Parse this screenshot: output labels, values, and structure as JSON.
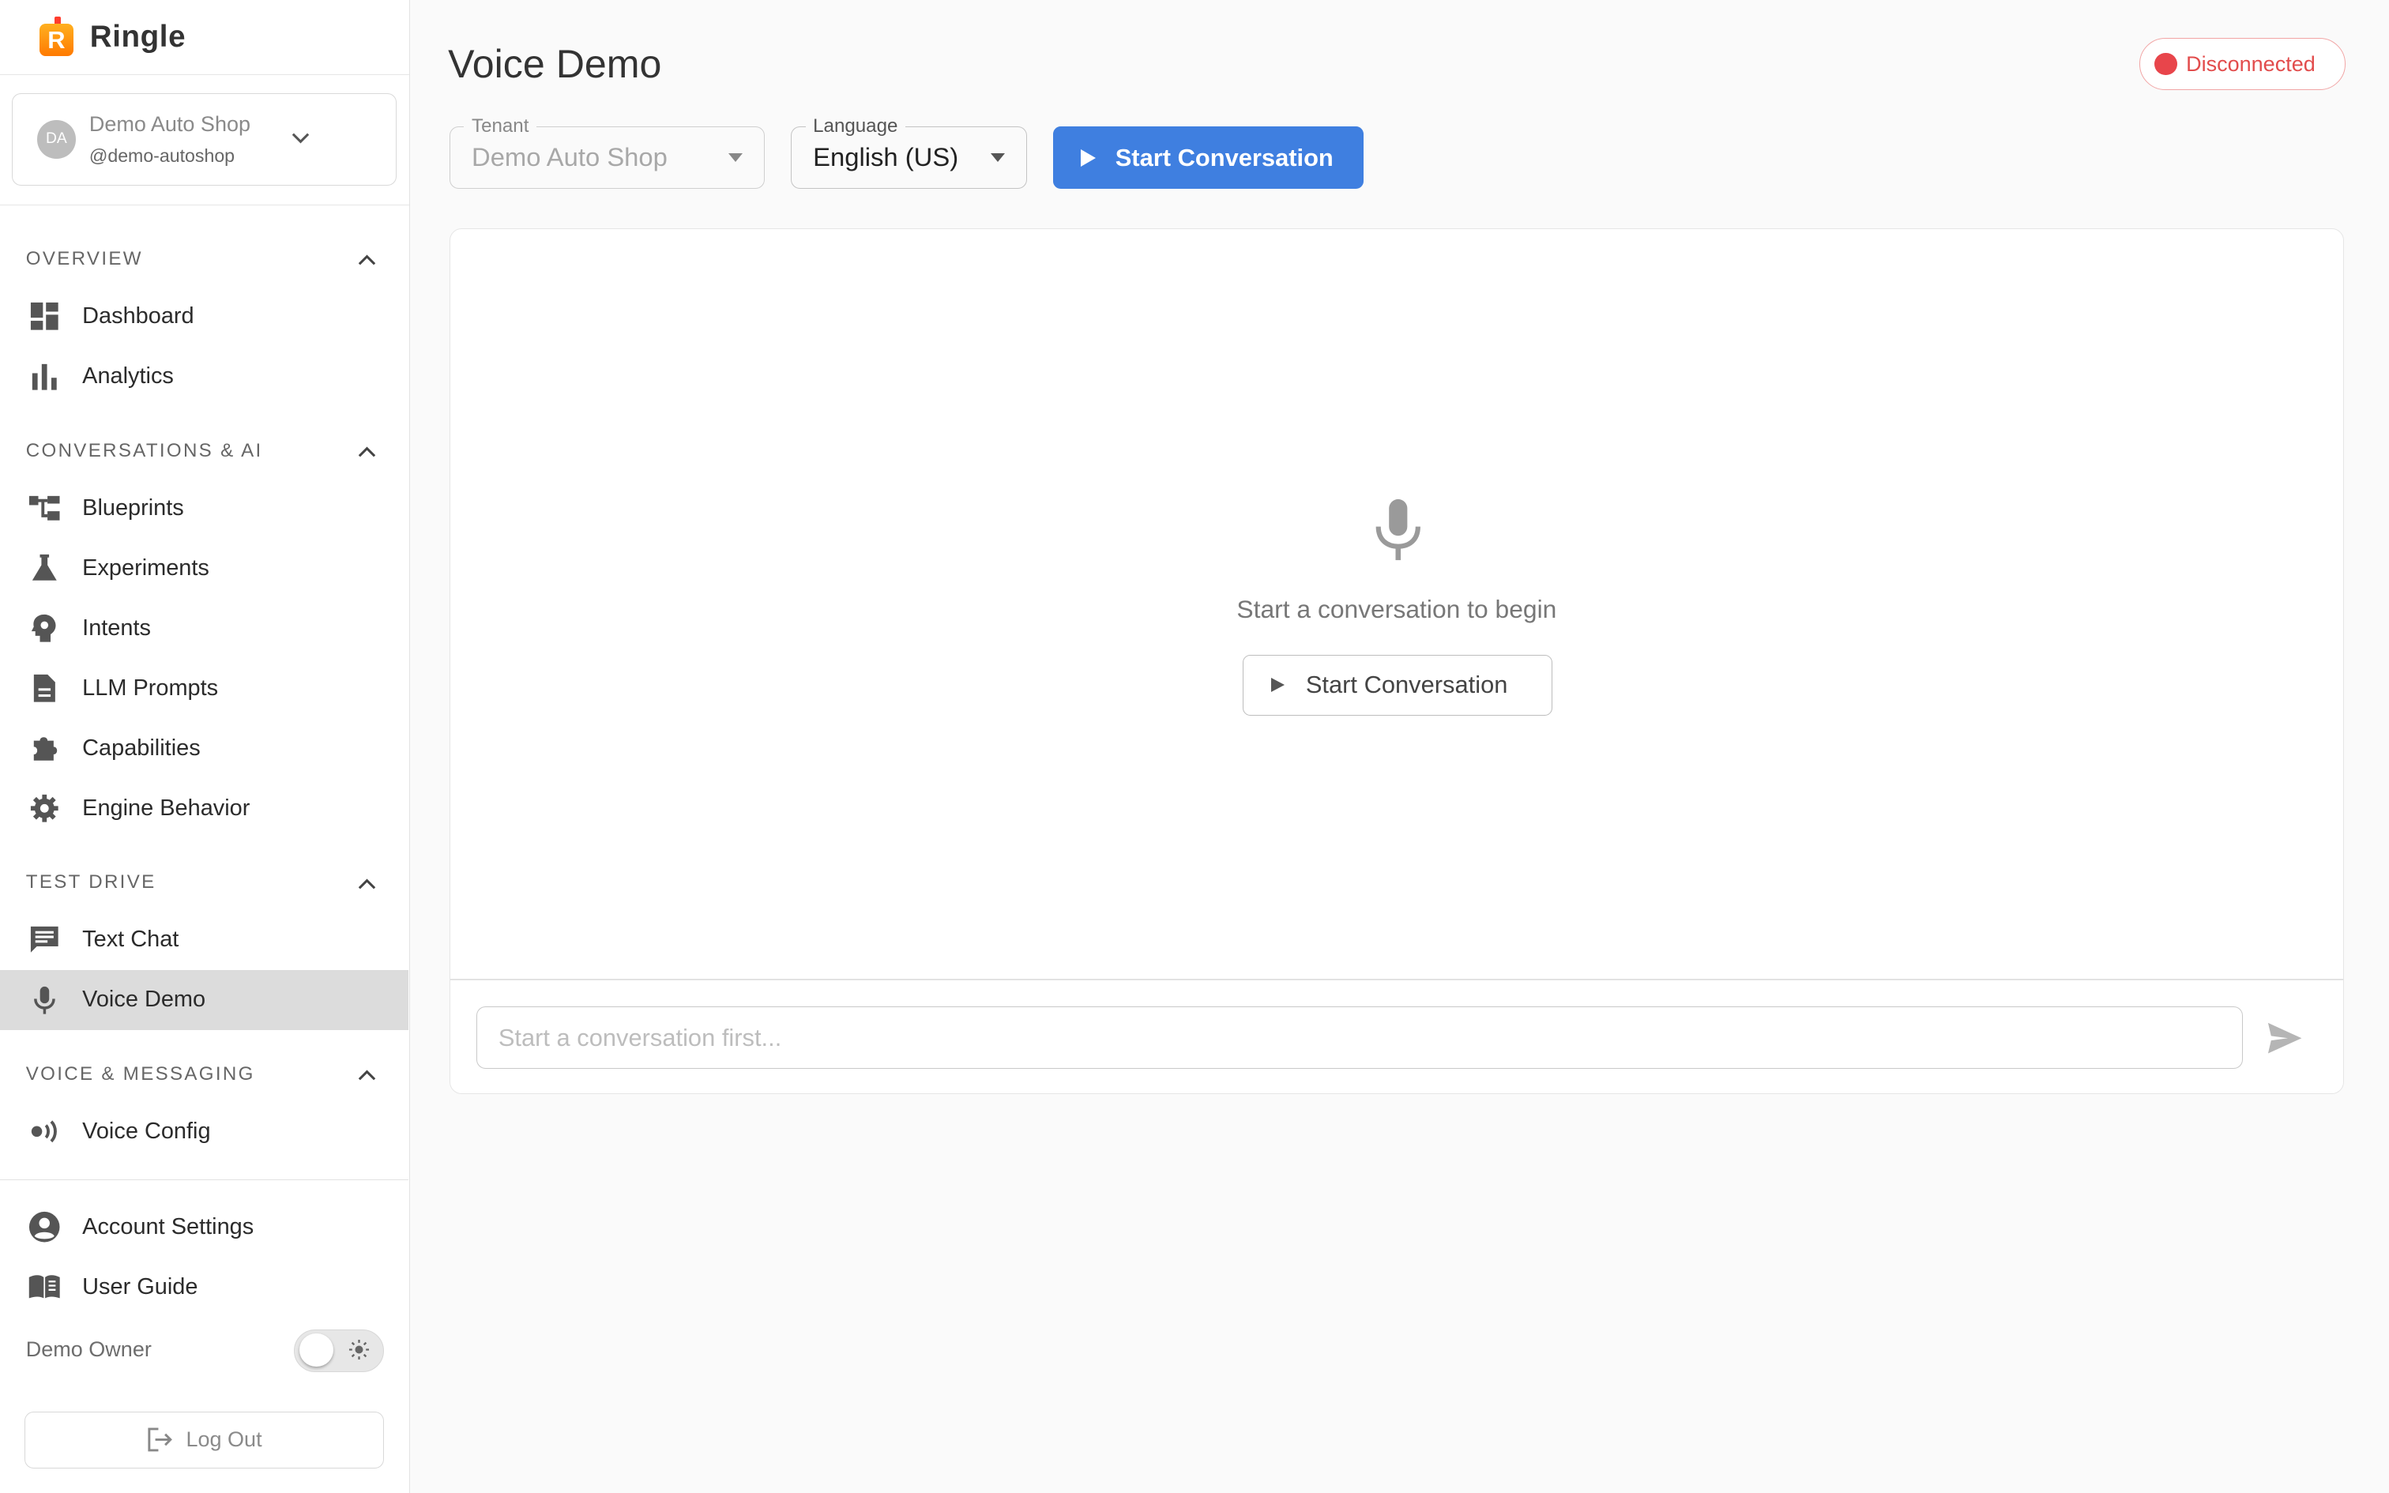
{
  "app": {
    "brand_name": "Ringle",
    "brand_letter": "R",
    "accent_color": "#3f7fe0"
  },
  "tenant_card": {
    "initials": "DA",
    "name": "Demo Auto Shop",
    "handle": "@demo-autoshop"
  },
  "sidebar": {
    "sections": [
      {
        "title": "OVERVIEW",
        "items": [
          {
            "label": "Dashboard",
            "icon": "dashboard-icon"
          },
          {
            "label": "Analytics",
            "icon": "bar-chart-icon"
          }
        ]
      },
      {
        "title": "CONVERSATIONS & AI",
        "items": [
          {
            "label": "Blueprints",
            "icon": "blueprint-icon"
          },
          {
            "label": "Experiments",
            "icon": "flask-icon"
          },
          {
            "label": "Intents",
            "icon": "psychology-icon"
          },
          {
            "label": "LLM Prompts",
            "icon": "document-icon"
          },
          {
            "label": "Capabilities",
            "icon": "puzzle-icon"
          },
          {
            "label": "Engine Behavior",
            "icon": "gear-icon"
          }
        ]
      },
      {
        "title": "TEST DRIVE",
        "items": [
          {
            "label": "Text Chat",
            "icon": "chat-icon"
          },
          {
            "label": "Voice Demo",
            "icon": "microphone-icon",
            "active": true
          }
        ]
      },
      {
        "title": "VOICE & MESSAGING",
        "items": [
          {
            "label": "Voice Config",
            "icon": "voice-wave-icon"
          }
        ]
      }
    ],
    "footer": {
      "account_settings": "Account Settings",
      "user_guide": "User Guide",
      "owner_name": "Demo Owner",
      "logout": "Log Out"
    }
  },
  "main": {
    "title": "Voice Demo",
    "status": "Disconnected",
    "status_color": "#e8454b",
    "tenant_field": {
      "legend": "Tenant",
      "value": "Demo Auto Shop"
    },
    "language_field": {
      "legend": "Language",
      "value": "English (US)"
    },
    "start_button": "Start Conversation",
    "empty_state": {
      "text": "Start a conversation to begin",
      "button": "Start Conversation"
    },
    "message_input": {
      "placeholder": "Start a conversation first..."
    }
  }
}
